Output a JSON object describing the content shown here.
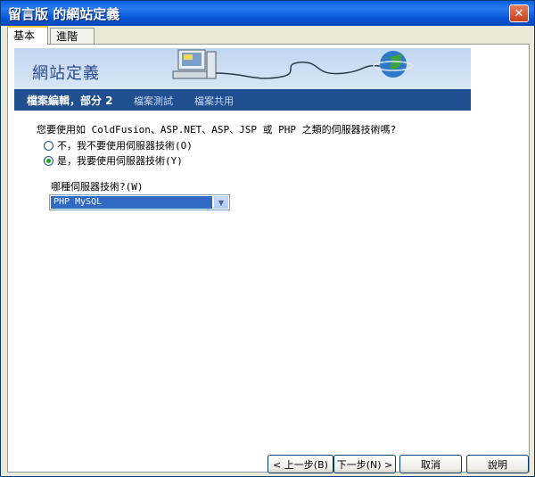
{
  "window": {
    "title": "留言版 的網站定義"
  },
  "tabs": [
    {
      "label": "基本",
      "active": true
    },
    {
      "label": "進階",
      "active": false
    }
  ],
  "banner": {
    "title": "網站定義"
  },
  "nav": {
    "current": "檔案編輯，部分 2",
    "test": "檔案測試",
    "share": "檔案共用"
  },
  "form": {
    "question": "您要使用如 ColdFusion、ASP.NET、ASP、JSP 或 PHP 之類的伺服器技術嗎?",
    "option_no": "不，我不要使用伺服器技術(O)",
    "option_yes": "是，我要使用伺服器技術(Y)",
    "selected_option": "yes",
    "which_label": "哪種伺服器技術?(W)",
    "server_tech": "PHP MySQL"
  },
  "buttons": {
    "back": "< 上一步(B)",
    "next": "下一步(N) >",
    "cancel": "取消",
    "help": "說明"
  },
  "colors": {
    "titlebar": "#0A5FE0",
    "nav_bar": "#1F4F8F",
    "banner": "#C2D6F0",
    "selection": "#316AC5"
  }
}
